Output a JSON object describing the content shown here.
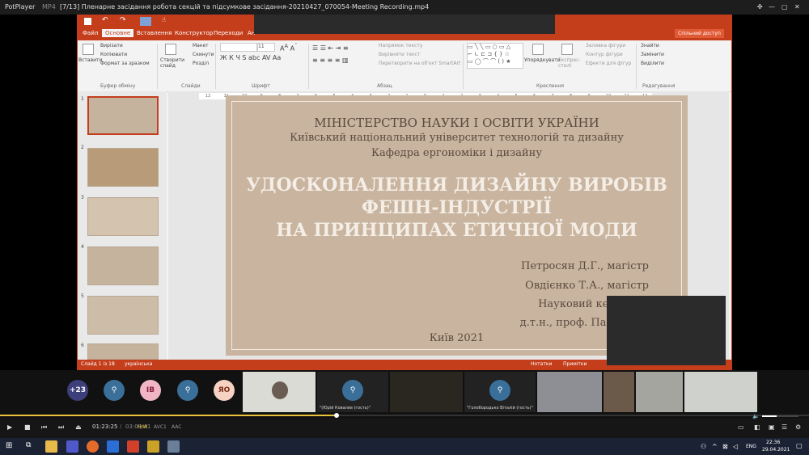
{
  "player": {
    "app_name": "PotPlayer",
    "format": "MP4",
    "title": "[7/13] Пленарне засідання робота секцій та підсумкове засідання-20210427_070054-Meeting Recording.mp4",
    "time_current": "01:23:25",
    "time_total": "03:09:41",
    "codec_1": "H/W",
    "codec_2": "AVC1",
    "codec_3": "AAC"
  },
  "ppt": {
    "tabs": [
      "Файл",
      "Основне",
      "Вставлення",
      "Конструктор",
      "Переходи",
      "Ан"
    ],
    "share_button": "Спільний доступ",
    "clipboard": {
      "paste": "Вставити",
      "cut": "Вирізати",
      "copy": "Копіювати",
      "format": "Формат за зразком",
      "group": "Буфер обміну"
    },
    "slides_group": {
      "new_slide": "Створити слайд",
      "layout": "Макет",
      "reset": "Скинути",
      "section": "Розділ",
      "group": "Слайди"
    },
    "font_group": {
      "size": "11",
      "group": "Шрифт"
    },
    "paragraph_group": {
      "direction": "Напрямок тексту",
      "align": "Вирівняти текст",
      "smartart": "Перетворити на об'єкт SmartArt",
      "group": "Абзац"
    },
    "drawing_group": {
      "arrange": "Упорядкувати",
      "quick_styles": "Експрес-стилі",
      "fill": "Заливка фігури",
      "outline": "Контур фігури",
      "effects": "Ефекти для фігур",
      "group": "Креслення"
    },
    "editing_group": {
      "find": "Знайти",
      "replace": "Замінити",
      "select": "Виділити",
      "group": "Редагування"
    },
    "ruler_ticks": [
      "12",
      "11",
      "10",
      "9",
      "8",
      "7",
      "6",
      "5",
      "4",
      "3",
      "2",
      "1",
      "0",
      "1",
      "2",
      "3",
      "4",
      "5",
      "6",
      "7",
      "8",
      "9",
      "10",
      "11",
      "12"
    ],
    "thumb_numbers": [
      "1",
      "2",
      "3",
      "4",
      "5",
      "6"
    ],
    "status": {
      "slide": "Слайд 1 із 18",
      "lang": "українська",
      "notes": "Нотатки",
      "comments": "Примітки",
      "zoom": "112 %"
    }
  },
  "slide": {
    "ministry": "МІНІСТЕРСТВО НАУКИ І ОСВІТИ УКРАЇНИ",
    "university": "Київський національний університет технологій та дизайну",
    "department": "Кафедра ергономіки і дизайну",
    "title_line1": "УДОСКОНАЛЕННЯ ДИЗАЙНУ ВИРОБІВ",
    "title_line2": "ФЕШН-ІНДУСТРІЇ",
    "title_line3": "НА ПРИНЦИПАХ ЕТИЧНОЇ МОДИ",
    "author1": "Петросян Д.Г., магістр",
    "author2": "Овдієнко Т.А., магістр",
    "supervisor_label": "Науковий керівник:",
    "supervisor": "д.т.н., проф. Пашкевич",
    "city_year": "Київ 2021"
  },
  "participants": {
    "more_count": "+23",
    "initials_1": "ІВ",
    "initials_2": "ЯО",
    "label_1": "\"(Юрій Ковалев (гость)\"",
    "label_2": "\"Голобородько Віталій (гость)\""
  },
  "taskbar": {
    "lang": "ENG",
    "time": "22:36",
    "date": "29.04.2021"
  },
  "colors": {
    "accent": "#c43e1c",
    "slide_bg": "#c9b49f",
    "slide_text": "#5b4a3e"
  }
}
